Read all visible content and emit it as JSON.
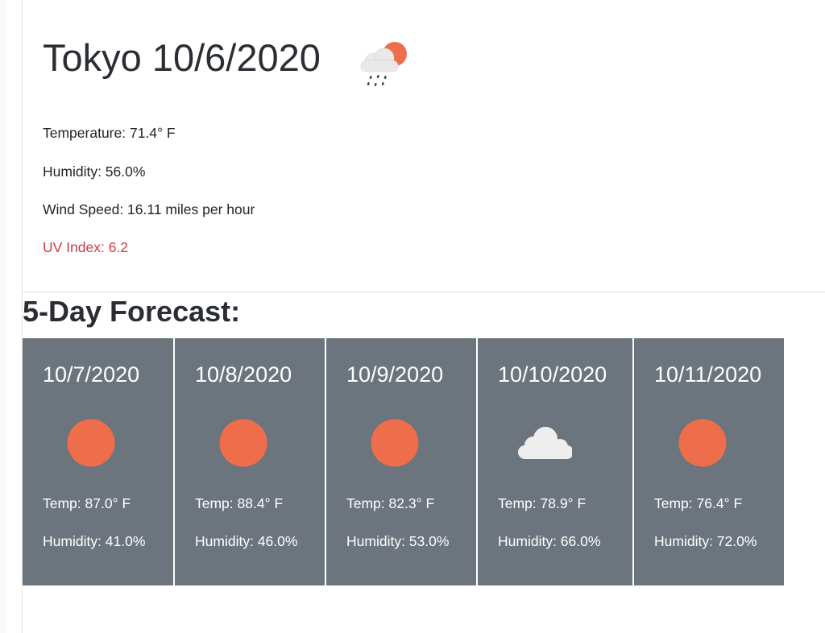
{
  "current": {
    "title": "Tokyo 10/6/2020",
    "icon": "rain-cloud-sun-icon",
    "temperature": "Temperature: 71.4° F",
    "humidity": "Humidity: 56.0%",
    "wind": "Wind Speed: 16.11 miles per hour",
    "uv": "UV Index: 6.2"
  },
  "forecast": {
    "heading": "5-Day Forecast:",
    "days": [
      {
        "date": "10/7/2020",
        "icon": "sun-icon",
        "temp": "Temp: 87.0° F",
        "humidity": "Humidity: 41.0%"
      },
      {
        "date": "10/8/2020",
        "icon": "sun-icon",
        "temp": "Temp: 88.4° F",
        "humidity": "Humidity: 46.0%"
      },
      {
        "date": "10/9/2020",
        "icon": "sun-icon",
        "temp": "Temp: 82.3° F",
        "humidity": "Humidity: 53.0%"
      },
      {
        "date": "10/10/2020",
        "icon": "cloud-icon",
        "temp": "Temp: 78.9° F",
        "humidity": "Humidity: 66.0%"
      },
      {
        "date": "10/11/2020",
        "icon": "sun-icon",
        "temp": "Temp: 76.4° F",
        "humidity": "Humidity: 72.0%"
      }
    ]
  },
  "colors": {
    "card_bg": "#6c757d",
    "sun": "#ee6e4b",
    "uv_text": "#d13a45",
    "cloud": "#eeeeee"
  }
}
